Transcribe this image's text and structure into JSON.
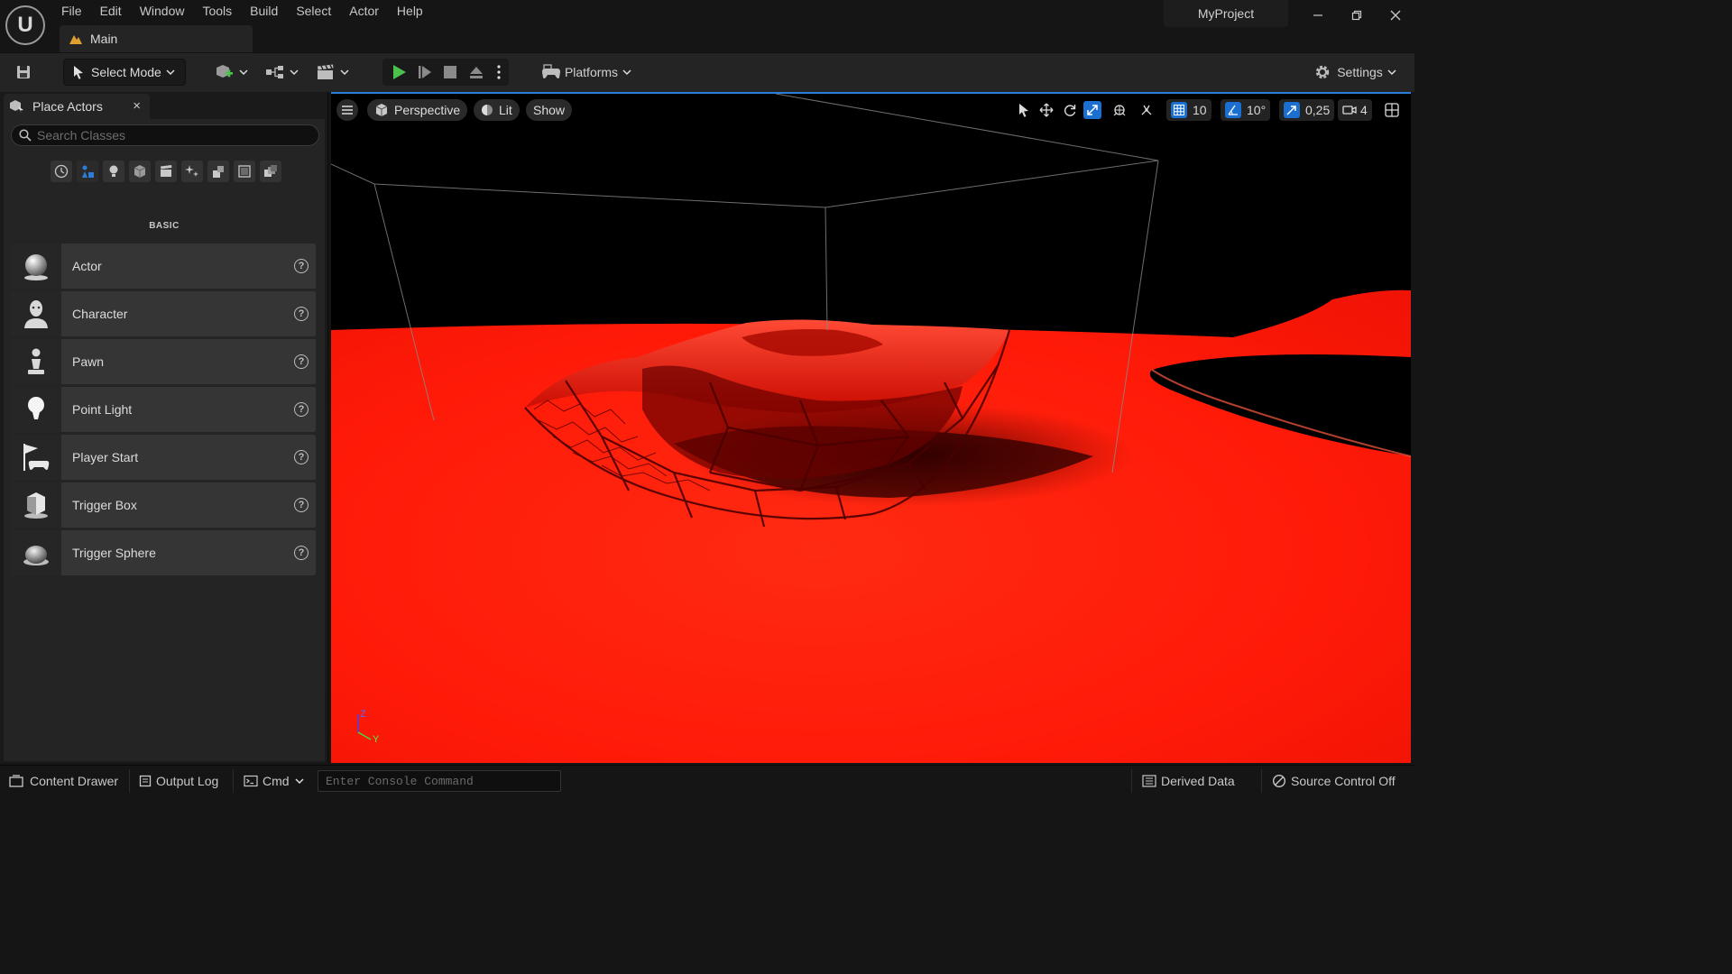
{
  "app": {
    "logo_text": "U",
    "project_name": "MyProject",
    "menu": [
      "File",
      "Edit",
      "Window",
      "Tools",
      "Build",
      "Select",
      "Actor",
      "Help"
    ],
    "level_tab": "Main"
  },
  "toolbar": {
    "select_mode_label": "Select Mode",
    "platforms_label": "Platforms",
    "settings_label": "Settings"
  },
  "place_actors": {
    "tab_title": "Place Actors",
    "close_glyph": "×",
    "search_placeholder": "Search Classes",
    "category_label": "BASIC",
    "items": [
      {
        "label": "Actor",
        "icon": "sphere-icon"
      },
      {
        "label": "Character",
        "icon": "character-icon"
      },
      {
        "label": "Pawn",
        "icon": "pawn-icon"
      },
      {
        "label": "Point Light",
        "icon": "point-light-icon"
      },
      {
        "label": "Player Start",
        "icon": "player-start-icon"
      },
      {
        "label": "Trigger Box",
        "icon": "trigger-box-icon"
      },
      {
        "label": "Trigger Sphere",
        "icon": "trigger-sphere-icon"
      }
    ],
    "help_glyph": "?"
  },
  "viewport": {
    "view_mode": "Perspective",
    "lighting_mode": "Lit",
    "show_label": "Show",
    "grid_snap": "10",
    "rotation_snap": "10°",
    "scale_snap": "0,25",
    "camera_speed": "4",
    "axis_z": "Z",
    "axis_y": "Y",
    "colors": {
      "floor": "#ff1a0a",
      "sky": "#000000",
      "accent": "#2b7dd8"
    }
  },
  "statusbar": {
    "content_drawer": "Content Drawer",
    "output_log": "Output Log",
    "cmd_label": "Cmd",
    "console_placeholder": "Enter Console Command",
    "derived_data": "Derived Data",
    "source_control": "Source Control Off"
  }
}
